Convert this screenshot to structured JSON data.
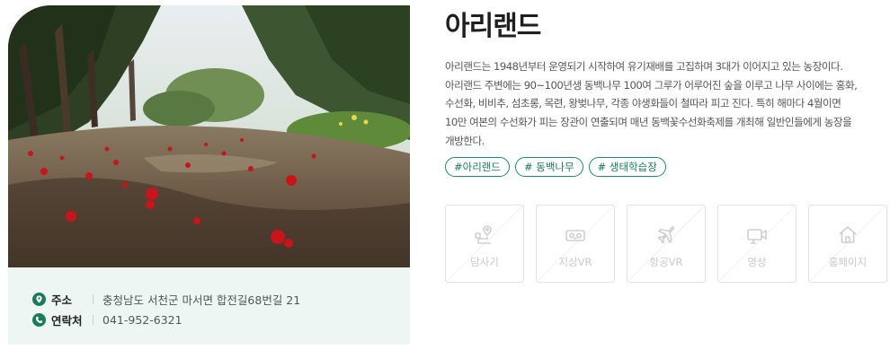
{
  "place": {
    "title": "아리랜드",
    "description": "아리랜드는 1948년부터 운영되기 시작하여 유기재배를 고집하며 3대가 이어지고 있는 농장이다.\n아리랜드 주변에는 90~100년생 동백나무 100여 그루가 어루어진 숲을 이루고 나무 사이에는 홍화,\n수선화, 비비추, 섬초롱, 목련, 왕벚나무, 각종 야생화들이 철따라 피고 진다. 특히 해마다 4월이면\n10만 여본의 수선화가 피는 장관이 연출되며 매년 동백꽃수선화축제를 개최해 일반인들에게 농장을\n개방한다."
  },
  "info": {
    "address_label": "주소",
    "address_value": "충청남도 서천군 마서면 합전길68번길 21",
    "phone_label": "연락처",
    "phone_value": "041-952-6321"
  },
  "tags": [
    "#아리랜드",
    "# 동백나무",
    "# 생태학습장"
  ],
  "tiles": [
    {
      "label": "담사기",
      "icon": "route-pin-icon"
    },
    {
      "label": "지상VR",
      "icon": "vr-headset-icon"
    },
    {
      "label": "항공VR",
      "icon": "airplane-icon"
    },
    {
      "label": "영상",
      "icon": "video-camera-icon"
    },
    {
      "label": "홈페이지",
      "icon": "home-icon"
    }
  ],
  "colors": {
    "accent": "#1a7a5c",
    "info_bg": "#edf6f3",
    "tile_disabled": "#c9c9c9"
  }
}
